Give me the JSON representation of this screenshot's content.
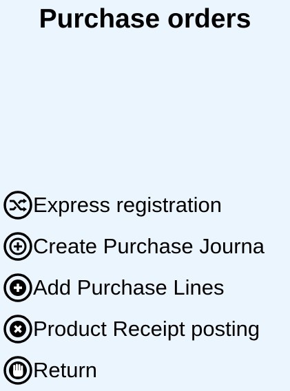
{
  "page": {
    "title": "Purchase orders",
    "background": "#eaf5fd"
  },
  "menu": {
    "items": [
      {
        "label": "Express registration",
        "icon": "shuffle-icon"
      },
      {
        "label": "Create Purchase Journa",
        "icon": "plus-circle-icon"
      },
      {
        "label": "Add Purchase Lines",
        "icon": "plus-circle-filled-icon"
      },
      {
        "label": "Product Receipt posting",
        "icon": "close-circle-filled-icon"
      },
      {
        "label": "Return",
        "icon": "hand-stop-icon"
      }
    ]
  }
}
